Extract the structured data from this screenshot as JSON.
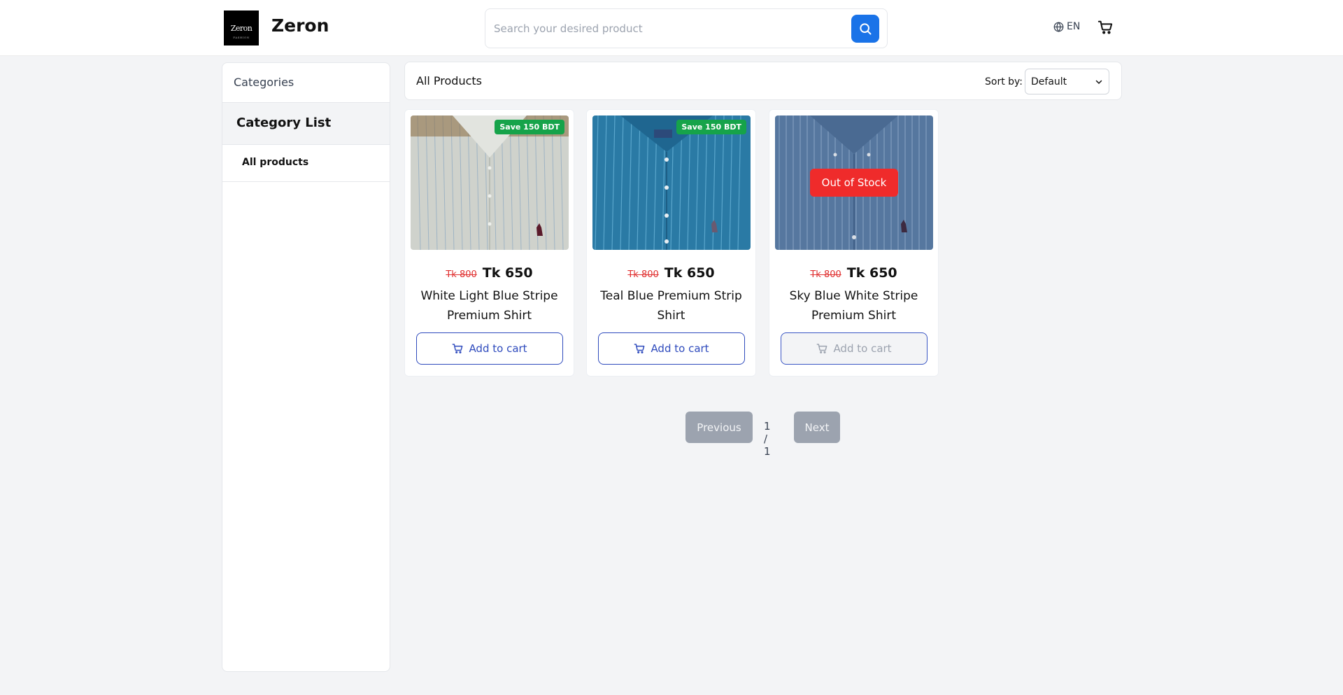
{
  "header": {
    "logo_text": "Zeron",
    "logo_subtext": "FASHION",
    "brand_name": "Zeron",
    "search_placeholder": "Search your desired product",
    "search_value": "",
    "language": "EN",
    "accent_color": "#1a73e8"
  },
  "sidebar": {
    "heading": "Categories",
    "title": "Category List",
    "items": [
      {
        "label": "All products"
      }
    ]
  },
  "toolbar": {
    "title": "All Products",
    "sort_label": "Sort by:",
    "sort_value": "Default"
  },
  "products": [
    {
      "name": "White Light Blue Stripe Premium Shirt",
      "old_price": "Tk 800",
      "price": "Tk 650",
      "badge": "Save 150 BDT",
      "in_stock": true,
      "button": "Add to cart",
      "image_color": "#d9dcd6"
    },
    {
      "name": "Teal Blue Premium Strip Shirt",
      "old_price": "Tk 800",
      "price": "Tk 650",
      "badge": "Save 150 BDT",
      "in_stock": true,
      "button": "Add to cart",
      "image_color": "#2e7fa8"
    },
    {
      "name": "Sky Blue White Stripe Premium Shirt",
      "old_price": "Tk 800",
      "price": "Tk 650",
      "badge": "Out of Stock",
      "in_stock": false,
      "button": "Add to cart",
      "image_color": "#5678a3"
    }
  ],
  "pagination": {
    "previous": "Previous",
    "info": "1 / 1",
    "next": "Next"
  }
}
